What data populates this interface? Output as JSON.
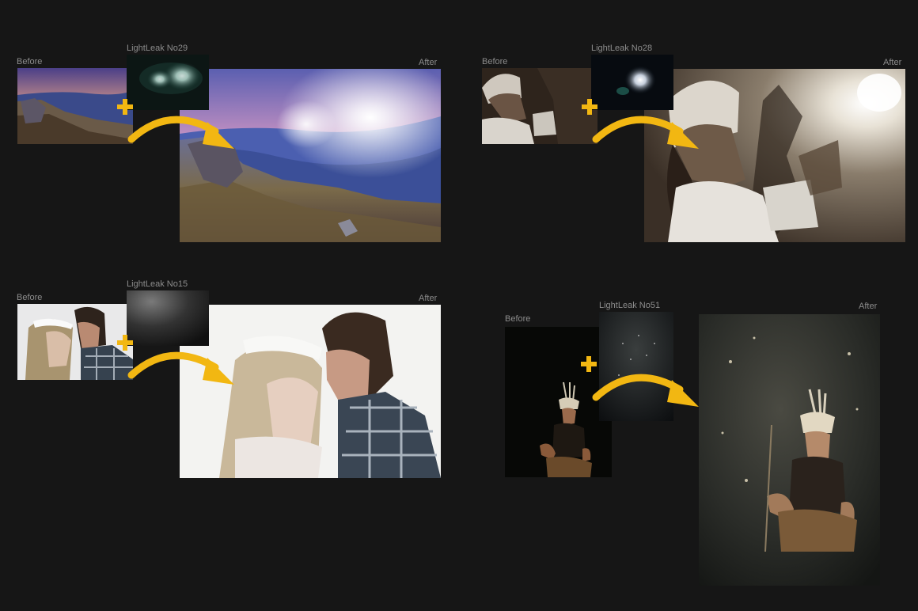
{
  "panels": [
    {
      "before_label": "Before",
      "overlay_label": "LightLeak No29",
      "after_label": "After"
    },
    {
      "before_label": "Before",
      "overlay_label": "LightLeak No28",
      "after_label": "After"
    },
    {
      "before_label": "Before",
      "overlay_label": "LightLeak No15",
      "after_label": "After"
    },
    {
      "before_label": "Before",
      "overlay_label": "LightLeak No51",
      "after_label": "After"
    }
  ],
  "accent_color": "#f2b712",
  "icons": [
    "plus-icon",
    "curved-arrow-icon"
  ]
}
